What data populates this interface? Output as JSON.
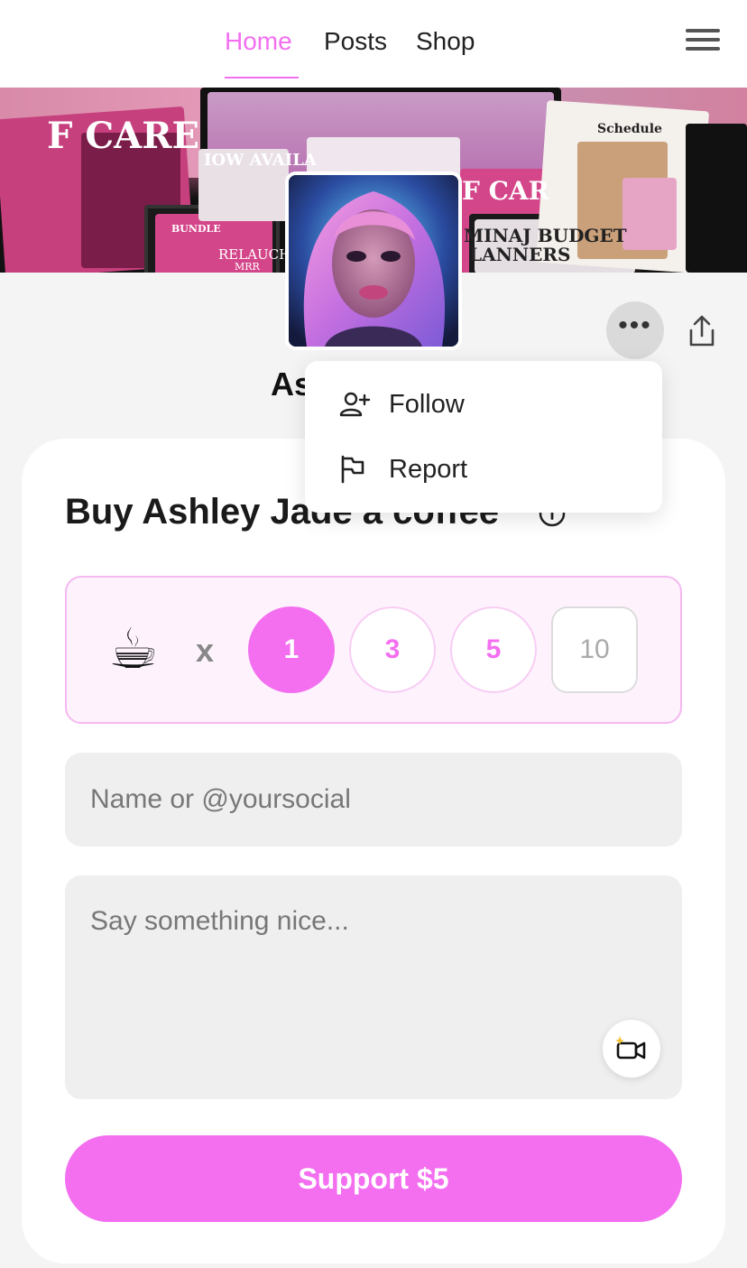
{
  "nav": {
    "tabs": [
      {
        "label": "Home",
        "active": true
      },
      {
        "label": "Posts",
        "active": false
      },
      {
        "label": "Shop",
        "active": false
      }
    ],
    "menu_icon": "hamburger-menu-icon"
  },
  "cover": {
    "texts": [
      "F CARE",
      "IOW AVAILA",
      "BUNDLE",
      "RELAUCH",
      "MRR",
      "F CAR",
      "MINAJ BUDGET",
      "LANNERS",
      "Schedule"
    ]
  },
  "profile": {
    "name_visible": "As",
    "more_icon": "more-horizontal-icon",
    "share_icon": "share-icon"
  },
  "dropdown": {
    "items": [
      {
        "label": "Follow",
        "icon": "user-plus-icon"
      },
      {
        "label": "Report",
        "icon": "flag-icon"
      }
    ]
  },
  "support": {
    "title": "Buy Ashley Jade a coffee",
    "info_icon": "info-icon",
    "cup_emoji": "☕",
    "multiplier": "x",
    "quantities": [
      "1",
      "3",
      "5",
      "10"
    ],
    "selected_quantity": "1",
    "name_placeholder": "Name or @yoursocial",
    "message_placeholder": "Say something nice...",
    "video_icon": "video-camera-sparkle-icon",
    "button_label": "Support $5"
  },
  "colors": {
    "accent": "#f36ff0",
    "accent_light": "#fef3fd",
    "field_bg": "#efefef",
    "page_bg": "#f4f4f5"
  }
}
